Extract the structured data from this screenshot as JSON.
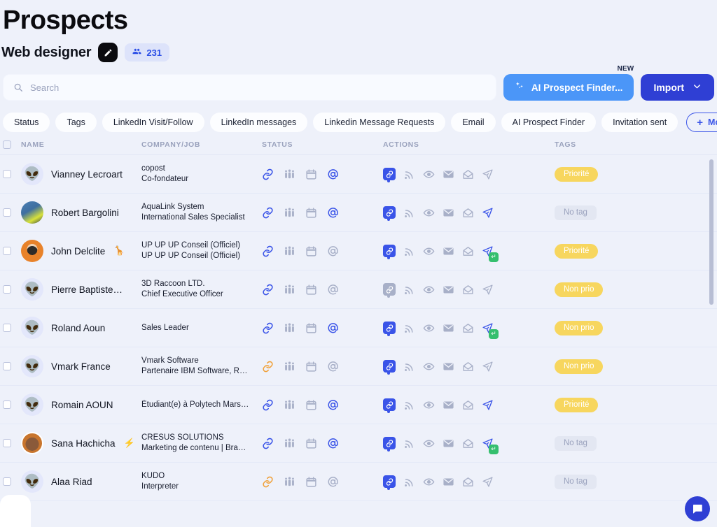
{
  "header": {
    "title": "Prospects",
    "subtitle": "Web designer",
    "black_chip_icon": "pen-icon",
    "count_icon": "people-icon",
    "count": "231"
  },
  "search": {
    "icon": "search-icon",
    "value": "",
    "placeholder": "Search"
  },
  "actions_bar": {
    "ai_button_label": "AI Prospect Finder...",
    "ai_button_icon": "sparkle-icon",
    "ai_badge": "NEW",
    "import_label": "Import",
    "import_icon": "chevron-down-icon"
  },
  "filters": [
    {
      "label": "Status"
    },
    {
      "label": "Tags"
    },
    {
      "label": "LinkedIn Visit/Follow"
    },
    {
      "label": "LinkedIn messages"
    },
    {
      "label": "Linkedin Message Requests"
    },
    {
      "label": "Email"
    },
    {
      "label": "AI Prospect Finder"
    },
    {
      "label": "Invitation sent"
    }
  ],
  "more_filters": {
    "label": "More filters",
    "icon": "plus-icon"
  },
  "table": {
    "columns": [
      "NAME",
      "COMPANY/JOB",
      "STATUS",
      "ACTIONS",
      "TAGS"
    ],
    "rows": [
      {
        "name": "Vianney Lecroart",
        "name_emoji": "",
        "avatar": "alien",
        "company": "copost",
        "job": "Co-fondateur",
        "status": {
          "link": "blue",
          "people": "gray",
          "calendar": "gray",
          "at": "blue"
        },
        "actions": {
          "link_badge": "on",
          "rss": "gray",
          "eye": "gray",
          "mail": "gray",
          "openmail": "gray",
          "send": "gray",
          "reply_badge": false
        },
        "tag": "Priorité",
        "tag_type": "prio"
      },
      {
        "name": "Robert Bargolini",
        "name_emoji": "",
        "avatar": "photo1",
        "company": "AquaLink System",
        "job": "International Sales Specialist",
        "status": {
          "link": "blue",
          "people": "gray",
          "calendar": "gray",
          "at": "blue"
        },
        "actions": {
          "link_badge": "on",
          "rss": "gray",
          "eye": "gray",
          "mail": "gray",
          "openmail": "gray",
          "send": "blue",
          "reply_badge": false
        },
        "tag": "No tag",
        "tag_type": "none"
      },
      {
        "name": "John Delclite",
        "name_emoji": "🦒",
        "avatar": "photo2",
        "company": "UP UP UP Conseil (Officiel)",
        "job": "UP UP UP Conseil (Officiel)",
        "status": {
          "link": "blue",
          "people": "gray",
          "calendar": "gray",
          "at": "gray"
        },
        "actions": {
          "link_badge": "on",
          "rss": "gray",
          "eye": "gray",
          "mail": "gray",
          "openmail": "gray",
          "send": "blue",
          "reply_badge": true
        },
        "tag": "Priorité",
        "tag_type": "prio"
      },
      {
        "name": "Pierre Baptiste…",
        "name_emoji": "",
        "avatar": "alien",
        "company": "3D Raccoon LTD.",
        "job": "Chief Executive Officer",
        "status": {
          "link": "blue",
          "people": "gray",
          "calendar": "gray",
          "at": "gray"
        },
        "actions": {
          "link_badge": "off",
          "rss": "gray",
          "eye": "gray",
          "mail": "gray",
          "openmail": "gray",
          "send": "gray",
          "reply_badge": false
        },
        "tag": "Non prio",
        "tag_type": "nonprio"
      },
      {
        "name": "Roland Aoun",
        "name_emoji": "",
        "avatar": "alien",
        "company": "",
        "job": "Sales Leader",
        "status": {
          "link": "blue",
          "people": "gray",
          "calendar": "gray",
          "at": "blue"
        },
        "actions": {
          "link_badge": "on",
          "rss": "gray",
          "eye": "gray",
          "mail": "gray",
          "openmail": "gray",
          "send": "blue",
          "reply_badge": true
        },
        "tag": "Non prio",
        "tag_type": "nonprio"
      },
      {
        "name": "Vmark France",
        "name_emoji": "",
        "avatar": "alien",
        "company": "Vmark Software",
        "job": "Partenaire IBM Software, R…",
        "status": {
          "link": "orange",
          "people": "gray",
          "calendar": "gray",
          "at": "gray"
        },
        "actions": {
          "link_badge": "on",
          "rss": "gray",
          "eye": "gray",
          "mail": "gray",
          "openmail": "gray",
          "send": "gray",
          "reply_badge": false
        },
        "tag": "Non prio",
        "tag_type": "nonprio"
      },
      {
        "name": "Romain AOUN",
        "name_emoji": "",
        "avatar": "alien",
        "company": "",
        "job": "Étudiant(e) à Polytech Mars…",
        "status": {
          "link": "blue",
          "people": "gray",
          "calendar": "gray",
          "at": "blue"
        },
        "actions": {
          "link_badge": "on",
          "rss": "gray",
          "eye": "gray",
          "mail": "gray",
          "openmail": "gray",
          "send": "blue",
          "reply_badge": false
        },
        "tag": "Priorité",
        "tag_type": "prio"
      },
      {
        "name": "Sana Hachicha",
        "name_emoji": "⚡",
        "avatar": "photo3",
        "company": "CRESUS SOLUTIONS",
        "job": "Marketing de contenu | Bra…",
        "status": {
          "link": "blue",
          "people": "gray",
          "calendar": "gray",
          "at": "blue"
        },
        "actions": {
          "link_badge": "on",
          "rss": "gray",
          "eye": "gray",
          "mail": "gray",
          "openmail": "gray",
          "send": "blue",
          "reply_badge": true
        },
        "tag": "No tag",
        "tag_type": "none"
      },
      {
        "name": "Alaa Riad",
        "name_emoji": "",
        "avatar": "alien",
        "company": "KUDO",
        "job": "Interpreter",
        "status": {
          "link": "orange",
          "people": "gray",
          "calendar": "gray",
          "at": "gray"
        },
        "actions": {
          "link_badge": "on",
          "rss": "gray",
          "eye": "gray",
          "mail": "gray",
          "openmail": "gray",
          "send": "gray",
          "reply_badge": false
        },
        "tag": "No tag",
        "tag_type": "none"
      }
    ]
  },
  "widgets": {
    "chat_icon": "chat-bubble-icon"
  },
  "colors": {
    "background": "#eef1fa",
    "accent_blue": "#3a54e8",
    "import_blue": "#2f3fd4",
    "ai_blue": "#4b96f8",
    "tag_yellow": "#f7d65e",
    "icon_gray": "#a8b0c8",
    "link_orange": "#f0a13a",
    "reply_green": "#35bf6e"
  }
}
